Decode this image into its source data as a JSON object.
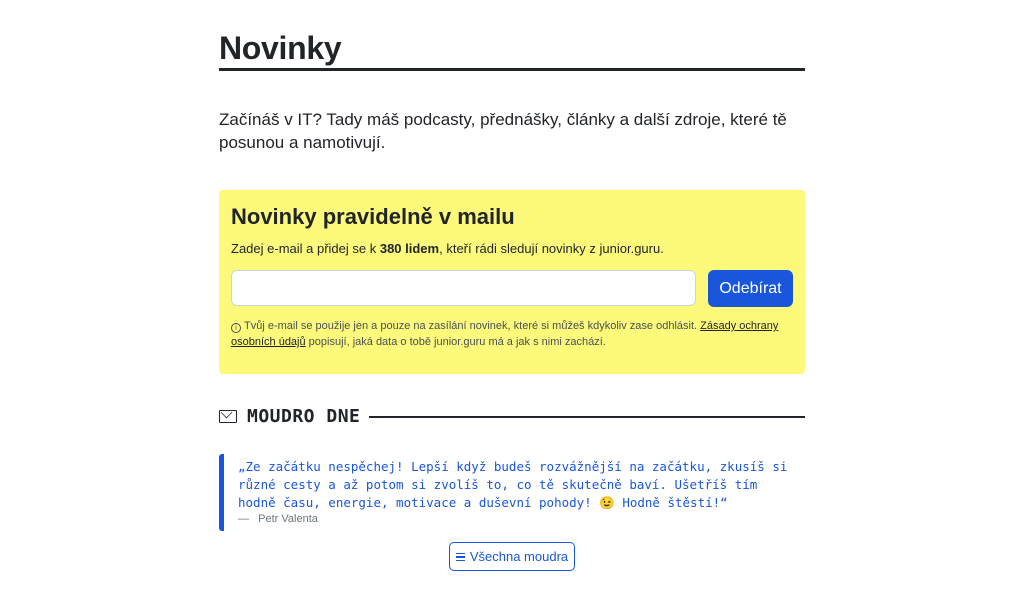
{
  "page": {
    "title": "Novinky",
    "intro": "Začínáš v IT? Tady máš podcasty, přednášky, články a další zdroje, které tě posunou a namotivují."
  },
  "newsletter": {
    "heading": "Novinky pravidelně v mailu",
    "lead_before": "Zadej e-mail a přidej se k ",
    "lead_count": "380 lidem",
    "lead_after": ", kteří rádi sledují novinky z junior.guru.",
    "email_value": "",
    "submit_label": "Odebírat",
    "note_before": "Tvůj e-mail se použije jen a pouze na zasílání novinek, které si můžeš kdykoliv zase odhlásit. ",
    "note_link": "Zásady ochrany osobních údajů",
    "note_after": " popisují, jaká data o tobě junior.guru má a jak s nimi zachází.",
    "info_icon": "info-circle-icon"
  },
  "wisdom": {
    "icon": "envelope-heart-icon",
    "section_title": "MOUDRO DNE",
    "quote": "„Ze začátku nespěchej! Lepší když budeš rozvážnější na začátku, zkusíš si různé cesty a až potom si zvolíš to, co tě skutečně baví. Ušetříš tím hodně času, energie, motivace a duševní pohody! 😉 Hodně štěstí!“",
    "author_dash": "—",
    "author": "Petr Valenta",
    "all_label": "Všechna moudra",
    "all_icon": "list-icon"
  },
  "colors": {
    "accent": "#1a56db",
    "highlight": "#fdf97a",
    "text": "#212529"
  }
}
